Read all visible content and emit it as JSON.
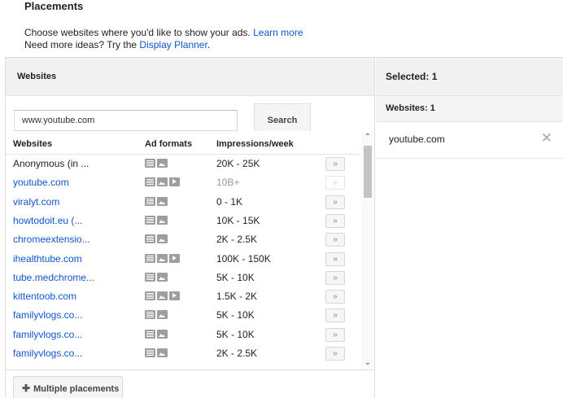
{
  "page": {
    "title": "Placements",
    "intro_line1": "Choose websites where you'd like to show your ads.",
    "learn_more": "Learn more",
    "intro_line2": "Need more ideas? Try the",
    "display_planner": "Display Planner",
    "period": "."
  },
  "left_panel": {
    "header": "Websites",
    "search_value": "www.youtube.com",
    "search_button": "Search",
    "columns": {
      "websites": "Websites",
      "ad_formats": "Ad formats",
      "impressions": "Impressions/week"
    },
    "rows": [
      {
        "site": "Anonymous (in ...",
        "formats": [
          "text",
          "image"
        ],
        "impressions": "20K - 25K",
        "link": false,
        "added": false
      },
      {
        "site": "youtube.com",
        "formats": [
          "text",
          "image",
          "video"
        ],
        "impressions": "10B+",
        "link": true,
        "added": true
      },
      {
        "site": "viralyt.com",
        "formats": [
          "text",
          "image"
        ],
        "impressions": "0 - 1K",
        "link": true,
        "added": false
      },
      {
        "site": "howtodoit.eu (...",
        "formats": [
          "text",
          "image"
        ],
        "impressions": "10K - 15K",
        "link": true,
        "added": false
      },
      {
        "site": "chromeextensio...",
        "formats": [
          "text",
          "image"
        ],
        "impressions": "2K - 2.5K",
        "link": true,
        "added": false
      },
      {
        "site": "ihealthtube.com",
        "formats": [
          "text",
          "image",
          "video"
        ],
        "impressions": "100K - 150K",
        "link": true,
        "added": false
      },
      {
        "site": "tube.medchrome...",
        "formats": [
          "text",
          "image"
        ],
        "impressions": "5K - 10K",
        "link": true,
        "added": false
      },
      {
        "site": "kittentoob.com",
        "formats": [
          "text",
          "image",
          "video"
        ],
        "impressions": "1.5K - 2K",
        "link": true,
        "added": false
      },
      {
        "site": "familyvlogs.co...",
        "formats": [
          "text",
          "image"
        ],
        "impressions": "5K - 10K",
        "link": true,
        "added": false
      },
      {
        "site": "familyvlogs.co...",
        "formats": [
          "text",
          "image"
        ],
        "impressions": "5K - 10K",
        "link": true,
        "added": false
      },
      {
        "site": "familyvlogs.co...",
        "formats": [
          "text",
          "image"
        ],
        "impressions": "2K - 2.5K",
        "link": true,
        "added": false
      }
    ],
    "add_glyph": "»",
    "multiple_placements": "Multiple placements"
  },
  "right_panel": {
    "header": "Selected: 1",
    "subheader": "Websites: 1",
    "selected": [
      {
        "site": "youtube.com"
      }
    ],
    "remove_glyph": "✕"
  }
}
